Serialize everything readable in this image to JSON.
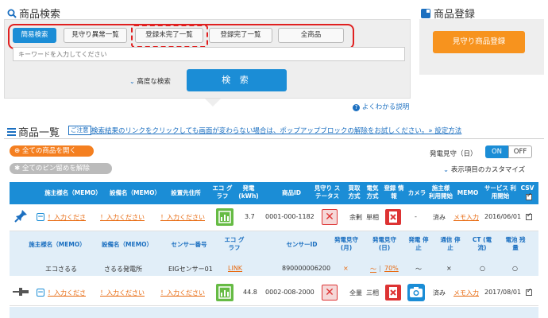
{
  "search": {
    "title": "商品検索",
    "tabs": [
      {
        "label": "簡易検索"
      },
      {
        "label": "見守り異常一覧"
      },
      {
        "label": "登録未完了一覧"
      },
      {
        "label": "登録完了一覧"
      },
      {
        "label": "全商品"
      }
    ],
    "keyword_placeholder": "キーワードを入力してください",
    "advanced_label": "高度な検索",
    "search_button": "検 索",
    "help_link": "よくわかる説明"
  },
  "register": {
    "title": "商品登録",
    "button": "見守り商品登録"
  },
  "list": {
    "title": "商品一覧",
    "note_badge": "ご注意",
    "note_text": "検索結果のリンクをクリックしても画面が変わらない場合は、ポップアップブロックの解除をお試しください。» 設定方法",
    "open_all": "全ての商品を開く",
    "unpin_all": "全てのピン留めを解除",
    "elec_label": "発電見守（日）",
    "toggle_on": "ON",
    "toggle_off": "OFF",
    "customize": "表示項目のカスタマイズ"
  },
  "table": {
    "headers": [
      "施主様名（MEMO）",
      "設備名（MEMO）",
      "設置先住所",
      "エコ グラフ",
      "発電 (kWh)",
      "商品ID",
      "見守り ステータス",
      "買取 方式",
      "電気 方式",
      "登録 情報",
      "カメラ",
      "施主様 利用開始",
      "MEMO",
      "サービス 利用開始",
      "CSV"
    ],
    "row1": {
      "owner": "！入力くださ",
      "equipment": "！入力ください",
      "address": "！入力ください",
      "kwh": "3.7",
      "product_id": "0001-000-1182",
      "purchase": "余剰",
      "electric": "単相",
      "camera": "-",
      "owner_start": "済み",
      "memo": "メモ入力",
      "service_start": "2016/06/01"
    },
    "sub_headers": [
      "施主様名（MEMO）",
      "設備名（MEMO）",
      "センサー番号",
      "エコ グラフ",
      "センサーID",
      "発電見守 (月)",
      "発電見守 (日)",
      "発電 停止",
      "通信 停止",
      "CT (電流)",
      "電池 残量"
    ],
    "sub_row": {
      "owner": "エコさるる",
      "equipment": "さるる発電所",
      "sensor_no": "EIGセンサー01",
      "eco_link": "LINK",
      "sensor_id": "890000006200",
      "monthly": "×",
      "daily_a": "～",
      "daily_b": "70%",
      "gen_stop": "～",
      "comm_stop": "×",
      "ct": "○",
      "battery": "○"
    },
    "row2": {
      "owner": "！入力くださ",
      "equipment": "！入力ください",
      "address": "！入力ください",
      "kwh": "44.8",
      "product_id": "0002-008-2000",
      "purchase": "全量",
      "electric": "三相",
      "owner_start": "済み",
      "memo": "メモ入力",
      "service_start": "2017/08/01"
    }
  }
}
